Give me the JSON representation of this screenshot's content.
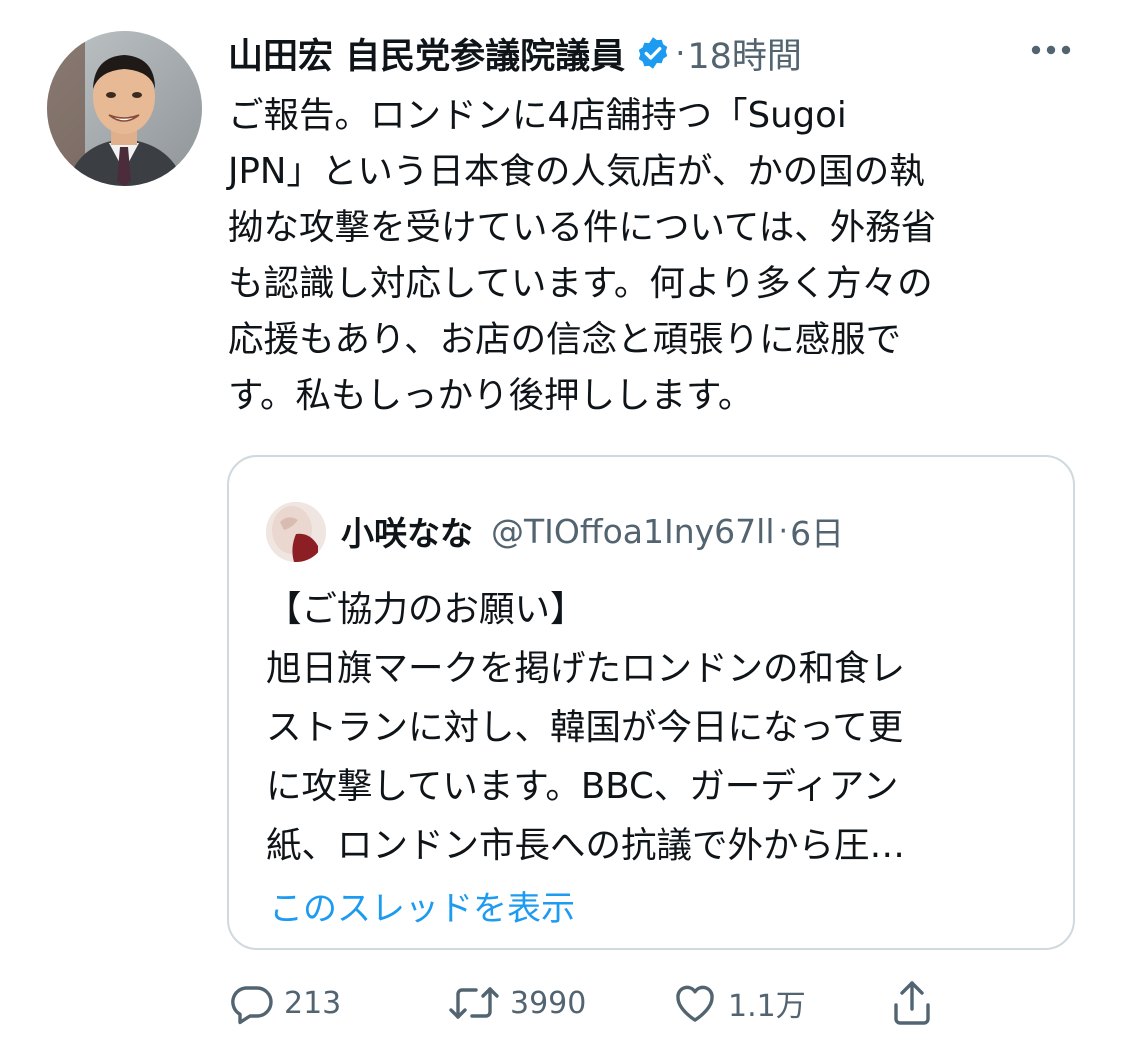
{
  "tweet": {
    "author_name": "山田宏 自民党参議院議員",
    "time": "18時間",
    "separator": "·",
    "text": "ご報告。ロンドンに4店舗持つ「Sugoi\nJPN」という日本食の人気店が、かの国の執\n拗な攻撃を受けている件については、外務省\nも認識し対応しています。何より多く方々の\n応援もあり、お店の信念と頑張りに感服で\nす。私もしっかり後押しします。"
  },
  "quote": {
    "name": "小咲なな",
    "handle": "@TIOffoa1Iny67ll",
    "separator": "·",
    "time": "6日",
    "text": "【ご協力のお願い】\n旭日旗マークを掲げたロンドンの和食レ\nストランに対し、韓国が今日になって更\nに攻撃しています。BBC、ガーディアン\n紙、ロンドン市長への抗議で外から圧…",
    "show_thread": "このスレッドを表示"
  },
  "actions": {
    "reply_count": "213",
    "retweet_count": "3990",
    "like_count": "1.1万"
  },
  "icons": {
    "verified": "verified-badge-icon",
    "more": "more-options-icon",
    "reply": "reply-icon",
    "retweet": "retweet-icon",
    "like": "heart-icon",
    "share": "share-icon"
  },
  "colors": {
    "text": "#0f1419",
    "secondary": "#536471",
    "accent": "#1d9bf0",
    "border": "#cfd9de"
  }
}
